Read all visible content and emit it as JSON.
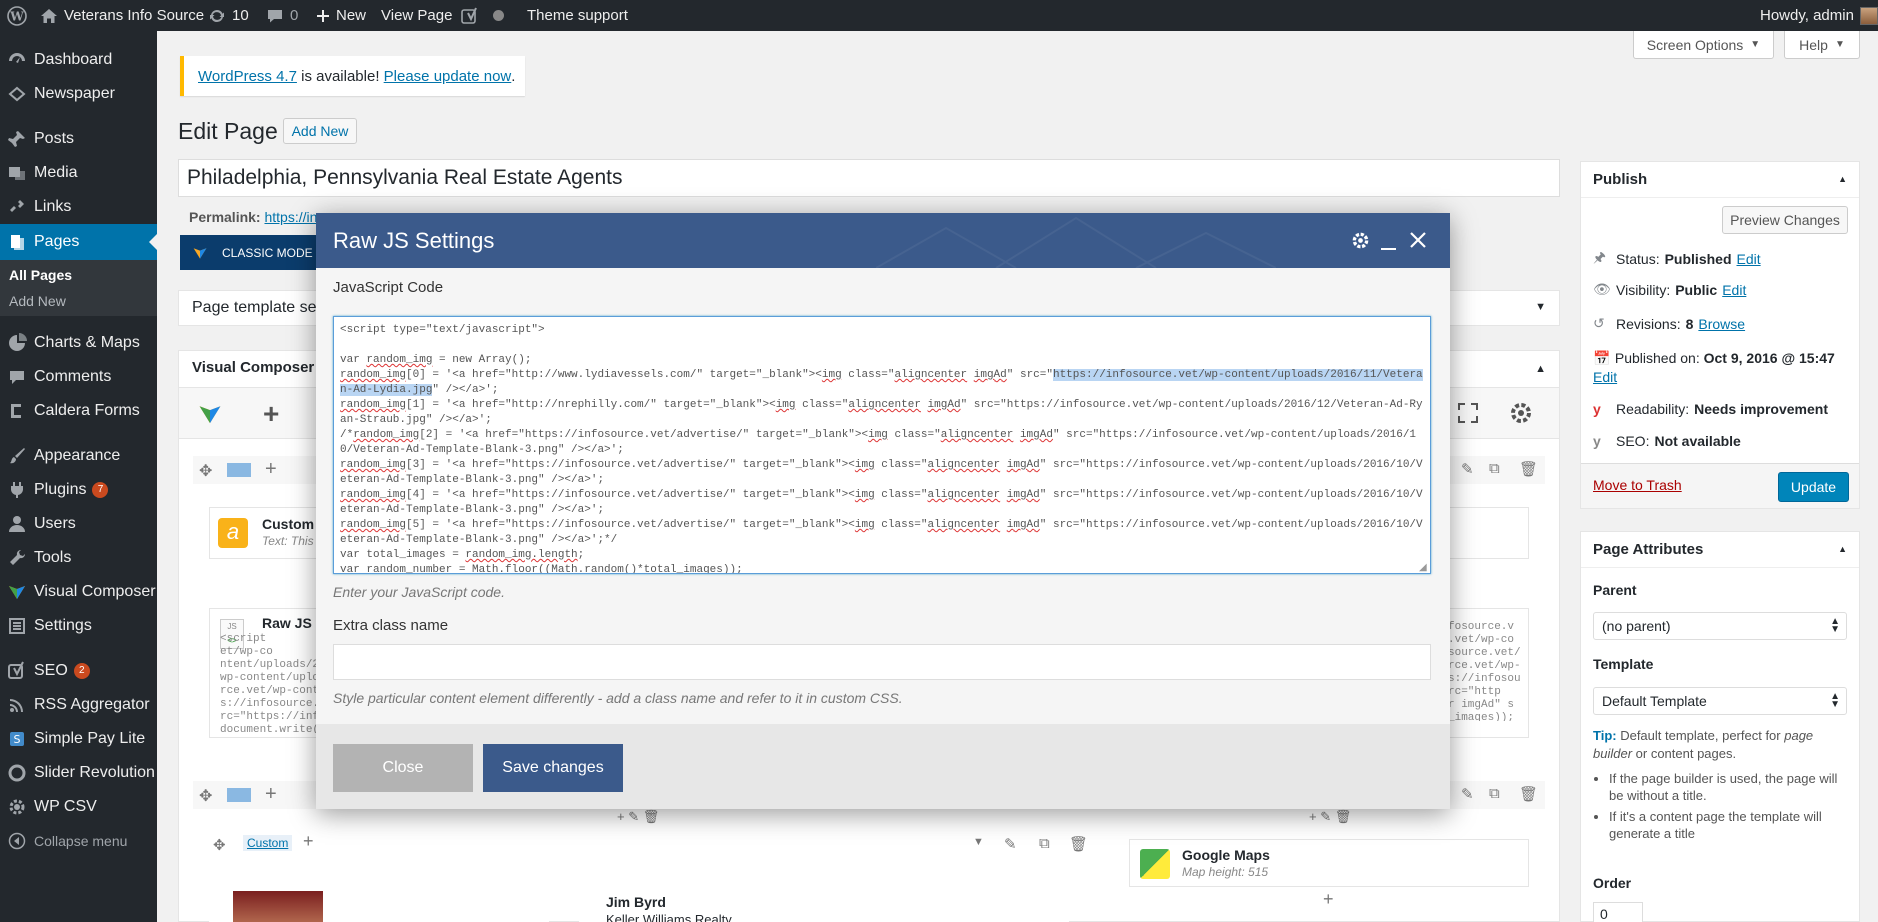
{
  "adminbar": {
    "site_name": "Veterans Info Source",
    "updates_count": "10",
    "comments_count": "0",
    "new_label": "New",
    "view_page_label": "View Page",
    "theme_support_label": "Theme support",
    "howdy_label": "Howdy, admin"
  },
  "sidebar": {
    "dashboard": "Dashboard",
    "newspaper": "Newspaper",
    "posts": "Posts",
    "media": "Media",
    "links": "Links",
    "pages": "Pages",
    "all_pages": "All Pages",
    "add_new": "Add New",
    "charts_maps": "Charts & Maps",
    "comments": "Comments",
    "caldera_forms": "Caldera Forms",
    "appearance": "Appearance",
    "plugins": "Plugins",
    "plugins_badge": "7",
    "users": "Users",
    "tools": "Tools",
    "visual_composer": "Visual Composer",
    "settings": "Settings",
    "seo": "SEO",
    "seo_badge": "2",
    "rss_aggregator": "RSS Aggregator",
    "simple_pay_lite": "Simple Pay Lite",
    "slider_revolution": "Slider Revolution",
    "wp_csv": "WP CSV",
    "collapse_menu": "Collapse menu"
  },
  "screen_options_label": "Screen Options",
  "help_label": "Help",
  "notice": {
    "version_link": "WordPress 4.7",
    "middle": " is available! ",
    "update_link": "Please update now",
    "end": "."
  },
  "heading": {
    "title": "Edit Page",
    "add_new": "Add New"
  },
  "post_title": "Philadelphia, Pennsylvania Real Estate Agents",
  "permalink": {
    "label": "Permalink:",
    "url": "https://in"
  },
  "classic_mode_label": "CLASSIC MODE",
  "page_template_label": "Page template set",
  "vc_panel_title": "Visual Composer",
  "vc": {
    "custom_heading_name": "Custom",
    "custom_heading_sub": "Text: This",
    "raw_js_name": "Raw JS",
    "raw_js_lines": "<script\net/wp-co\nntent/uploads/2\nwp-content/uplo\nrce.vet/wp-cont\ns://infosource.\nrc=\"https://inf\ndocument.write(",
    "raw_js_right_lines": "fosource.v\n.vet/wp-co\nsource.vet/\nrce.vet/wp-\ns://infosou\nrc=\"http\nr imgAd\" s\n_images));",
    "custom_tab": "Custom",
    "person_name": "Jim Byrd",
    "person_company": "Keller Williams Realty",
    "maps_name": "Google Maps",
    "maps_sub": "Map height: 515"
  },
  "publish": {
    "title": "Publish",
    "preview_btn": "Preview Changes",
    "status_label": "Status:",
    "status_value": "Published",
    "status_edit": "Edit",
    "visibility_label": "Visibility:",
    "visibility_value": "Public",
    "visibility_edit": "Edit",
    "revisions_label": "Revisions:",
    "revisions_value": "8",
    "revisions_browse": "Browse",
    "published_label": "Published on:",
    "published_value": "Oct 9, 2016 @ 15:47",
    "published_edit": "Edit",
    "readability_label": "Readability:",
    "readability_value": "Needs improvement",
    "seo_label": "SEO:",
    "seo_value": "Not available",
    "trash_label": "Move to Trash",
    "update_btn": "Update"
  },
  "attributes": {
    "title": "Page Attributes",
    "parent_label": "Parent",
    "parent_value": "(no parent)",
    "template_label": "Template",
    "template_value": "Default Template",
    "tip_label": "Tip:",
    "tip_text_1": " Default template, perfect for ",
    "tip_em_1": "page builder",
    "tip_text_2": " or content pages.",
    "bullet_1": "If the page builder is used, the page will be without a title.",
    "bullet_2": "If it's a content page the template will generate a title",
    "order_label": "Order",
    "order_value": "0"
  },
  "modal": {
    "title": "Raw JS Settings",
    "js_label": "JavaScript Code",
    "js_hint": "Enter your JavaScript code.",
    "extra_label": "Extra class name",
    "extra_value": "",
    "extra_hint": "Style particular content element differently - add a class name and refer to it in custom CSS.",
    "close_btn": "Close",
    "save_btn": "Save changes",
    "code": {
      "l1": "<script type=\"text/javascript\">",
      "l2": "",
      "l3a": "var ",
      "l3b": "random_img",
      "l3c": " = new Array();",
      "l4a": "random_img",
      "l4b": "[0] = '<a href=\"http://www.lydiavessels.com/\" target=\"_blank\"><",
      "l4c": "img",
      "l4d": " class=\"",
      "l4e": "aligncenter",
      "l4f": " ",
      "l4g": "imgAd",
      "l4h": "\" src=\"",
      "l4i": "https://infosource.vet/wp-content/uploads/2016/11/Veteran-Ad-Lydia.jpg",
      "l4j": "\" /></a>';",
      "l5a": "random_img",
      "l5b": "[1] = '<a href=\"http://nrephilly.com/\" target=\"_blank\"><",
      "l5c": "img",
      "l5d": " class=\"",
      "l5e": "aligncenter",
      "l5f": " ",
      "l5g": "imgAd",
      "l5h": "\" src=\"https://infosource.vet/wp-content/uploads/2016/12/Veteran-Ad-Ryan-Straub.jpg\" /></a>';",
      "l6a": "/*",
      "l6b": "random_img",
      "l6c": "[2] = '<a href=\"https://infosource.vet/advertise/\" target=\"_blank\"><",
      "l6d": "img",
      "l6e": " class=\"",
      "l6f": "aligncenter",
      "l6g": " ",
      "l6h": "imgAd",
      "l6i": "\" src=\"https://infosource.vet/wp-content/uploads/2016/10/Veteran-Ad-Template-Blank-3.png\" /></a>';",
      "l7a": "random_img",
      "l7b": "[3] = '<a href=\"https://infosource.vet/advertise/\" target=\"_blank\"><",
      "l7c": "img",
      "l7d": " class=\"",
      "l7e": "aligncenter",
      "l7f": " ",
      "l7g": "imgAd",
      "l7h": "\" src=\"https://infosource.vet/wp-content/uploads/2016/10/Veteran-Ad-Template-Blank-3.png\" /></a>';",
      "l8a": "random_img",
      "l8b": "[4] = '<a href=\"https://infosource.vet/advertise/\" target=\"_blank\"><",
      "l8c": "img",
      "l8d": " class=\"",
      "l8e": "aligncenter",
      "l8f": " ",
      "l8g": "imgAd",
      "l8h": "\" src=\"https://infosource.vet/wp-content/uploads/2016/10/Veteran-Ad-Template-Blank-3.png\" /></a>';",
      "l9a": "random_img",
      "l9b": "[5] = '<a href=\"https://infosource.vet/advertise/\" target=\"_blank\"><",
      "l9c": "img",
      "l9d": " class=\"",
      "l9e": "aligncenter",
      "l9f": " ",
      "l9g": "imgAd",
      "l9h": "\" src=\"https://infosource.vet/wp-content/uploads/2016/10/Veteran-Ad-Template-Blank-3.png\" /></a>';*/",
      "l10a": "var total_images = ",
      "l10b": "random_img.length",
      "l10c": ";",
      "l11a": "var random_number = Math.floor(",
      "l11b": "(Math.random()*total_images));"
    }
  },
  "colors": {
    "admin_bar": "#23282d",
    "accent": "#0073aa",
    "modal_header": "#3b5a8b",
    "save_button": "#3b5a8b",
    "notice_border": "#ffb900"
  }
}
